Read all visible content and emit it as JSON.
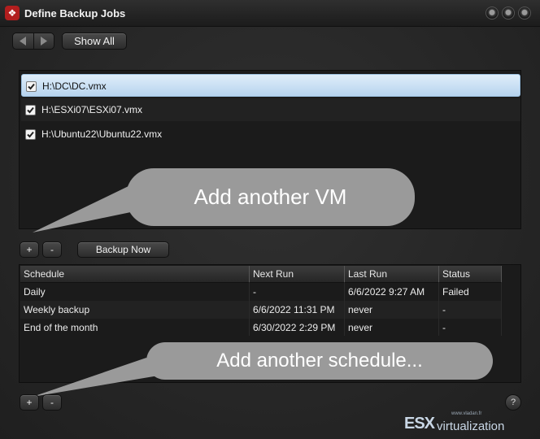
{
  "window": {
    "title": "Define Backup Jobs",
    "icon": "paw-icon"
  },
  "toolbar": {
    "show_all_label": "Show All"
  },
  "vm_list": {
    "items": [
      {
        "label": "H:\\DC\\DC.vmx",
        "checked": true,
        "selected": true
      },
      {
        "label": "H:\\ESXi07\\ESXi07.vmx",
        "checked": true,
        "selected": false
      },
      {
        "label": "H:\\Ubuntu22\\Ubuntu22.vmx",
        "checked": true,
        "selected": false
      }
    ],
    "add_label": "+",
    "remove_label": "-",
    "backup_now_label": "Backup Now"
  },
  "schedule": {
    "columns": [
      "Schedule",
      "Next Run",
      "Last Run",
      "Status"
    ],
    "rows": [
      {
        "schedule": "Daily",
        "next_run": "-",
        "last_run": "6/6/2022 9:27 AM",
        "status": "Failed"
      },
      {
        "schedule": "Weekly backup",
        "next_run": "6/6/2022 11:31 PM",
        "last_run": "never",
        "status": "-"
      },
      {
        "schedule": "End of the month",
        "next_run": "6/30/2022 2:29 PM",
        "last_run": "never",
        "status": "-"
      }
    ],
    "add_label": "+",
    "remove_label": "-"
  },
  "callouts": {
    "vm": "Add another VM",
    "schedule": "Add another schedule..."
  },
  "help_label": "?",
  "watermark": {
    "brand": "ESX",
    "suffix": "virtualization",
    "url": "www.vladan.fr"
  },
  "colors": {
    "selection": "#cfe3f5",
    "callout": "#9a9a9a",
    "app_icon": "#b21e1e"
  }
}
